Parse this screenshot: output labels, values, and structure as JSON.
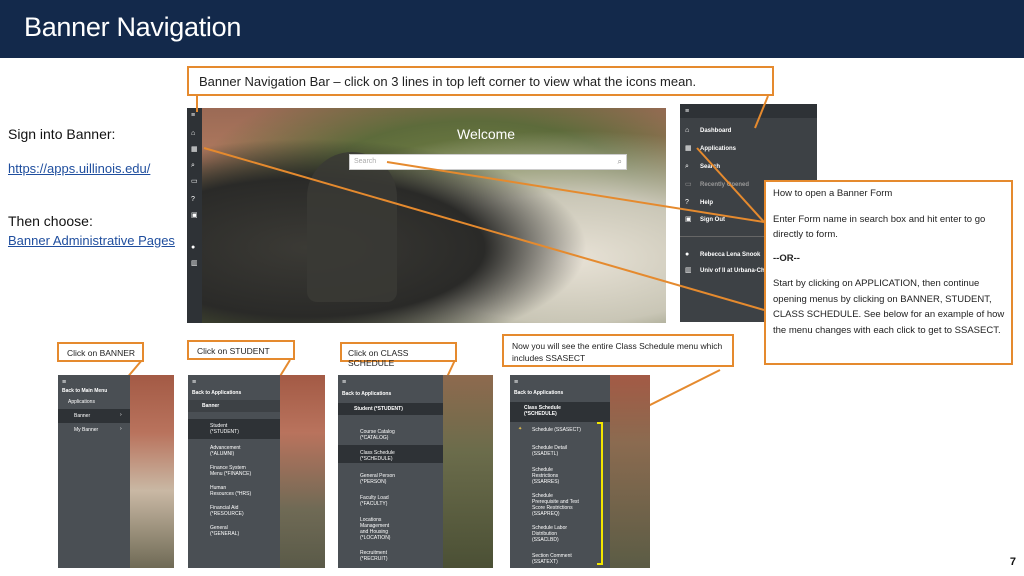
{
  "slide": {
    "title": "Banner Navigation",
    "page_number": "7"
  },
  "left": {
    "sign_in": "Sign into Banner:",
    "url": "https://apps.uillinois.edu/",
    "then_choose": "Then choose:",
    "admin_pages": "Banner Administrative Pages"
  },
  "callouts": {
    "nav_bar": "Banner Navigation Bar – click on 3 lines in top left corner to view what the icons mean.",
    "form_title": "How to open a Banner Form",
    "form_p1": "Enter Form name in search box and hit enter to go directly to form.",
    "form_or": "--OR--",
    "form_p2": "Start by clicking on APPLICATION, then continue opening menus by clicking on BANNER, STUDENT, CLASS SCHEDULE. See below for an example of how the menu changes with each click to get to SSASECT.",
    "click_banner": "Click on BANNER",
    "click_student": "Click on STUDENT",
    "click_class": "Click on CLASS SCHEDULE",
    "now_see": "Now you will see the entire Class Schedule menu which includes SSASECT"
  },
  "welcome_screen": {
    "welcome": "Welcome",
    "search_placeholder": "Search"
  },
  "expanded_menu": {
    "items": [
      "Dashboard",
      "Applications",
      "Search",
      "Recently Opened",
      "Help",
      "Sign Out"
    ],
    "user_name": "Rebecca Lena Snook",
    "institution": "Univ of Il at Urbana-Cha"
  },
  "panel1": {
    "back": "Back to Main Menu",
    "section": "Applications",
    "items": [
      "Banner",
      "My Banner"
    ]
  },
  "panel2": {
    "back": "Back to Applications",
    "section": "Banner",
    "items": [
      "Student\n(*STUDENT)",
      "Advancement\n(*ALUMNI)",
      "Finance System\nMenu (*FINANCE)",
      "Human\nResources (*HRS)",
      "Financial Aid\n(*RESOURCE)",
      "General\n(*GENERAL)"
    ]
  },
  "panel3": {
    "back": "Back to Applications",
    "section": "Student (*STUDENT)",
    "items": [
      "Course Catalog\n(*CATALOG)",
      "Class Schedule\n(*SCHEDULE)",
      "General Person\n(*PERSON)",
      "Faculty Load\n(*FACULTY)",
      "Locations\nManagement\nand Housing\n(*LOCATION)",
      "Recruitment\n(*RECRUIT)"
    ]
  },
  "panel4": {
    "back": "Back to Applications",
    "section": "Class Schedule\n(*SCHEDULE)",
    "items": [
      "Schedule (SSASECT)",
      "Schedule Detail\n(SSADETL)",
      "Schedule\nRestrictions\n(SSARRES)",
      "Schedule\nPrerequisite and Test\nScore Restrictions\n(SSAPREQ)",
      "Schedule Labor\nDistribution\n(SSACLBD)",
      "Section Comment\n(SSATEXT)"
    ]
  },
  "colors": {
    "header": "#13294b",
    "callout_border": "#e58a2e",
    "menu_panel": "#4a4f54",
    "link": "#1f4e9e",
    "highlight_bracket": "#f2e600"
  }
}
